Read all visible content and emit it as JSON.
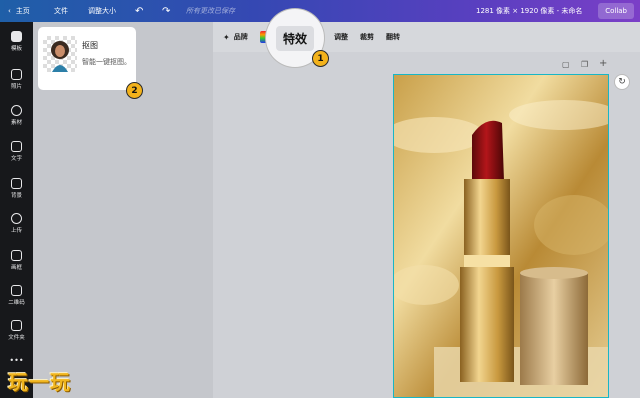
{
  "topbar": {
    "home": "主页",
    "file": "文件",
    "resize": "调整大小",
    "undo_icon": "undo-icon",
    "redo_icon": "redo-icon",
    "title_placeholder": "所有更改已保存",
    "dimensions": "1281 像素 × 1920 像素 - 未命名",
    "collab": "Collab"
  },
  "rail": {
    "items": [
      {
        "label": "模板",
        "icon": "template-icon"
      },
      {
        "label": "照片",
        "icon": "photo-icon"
      },
      {
        "label": "素材",
        "icon": "elements-icon"
      },
      {
        "label": "文字",
        "icon": "text-icon"
      },
      {
        "label": "背景",
        "icon": "background-icon"
      },
      {
        "label": "上传",
        "icon": "upload-icon"
      },
      {
        "label": "画框",
        "icon": "frame-icon"
      },
      {
        "label": "二维码",
        "icon": "qrcode-icon"
      },
      {
        "label": "文件夹",
        "icon": "folder-icon"
      }
    ]
  },
  "panel": {
    "card_title": "抠图",
    "card_subtitle": "智能一键抠图。"
  },
  "toolbar": {
    "brand": "品牌",
    "effects": "特效",
    "adjust": "调整",
    "crop": "裁剪",
    "flip": "翻转"
  },
  "badges": {
    "one": "1",
    "two": "2"
  },
  "watermark": "玩一玩",
  "colors": {
    "accent": "#f3b21b",
    "selection": "#18b6c6",
    "rail": "#17181b"
  }
}
